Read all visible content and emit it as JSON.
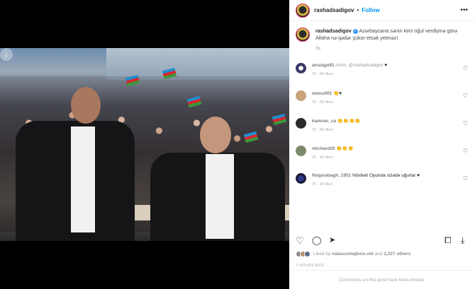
{
  "header": {
    "username": "rashadsadigov",
    "separator": "•",
    "follow_label": "Follow",
    "more_label": "•••"
  },
  "caption": {
    "username": "rashadsadigov",
    "text": "Azərbaycana sənin kimi oğul verdiyinə görə Allaha nə qədər şükür etsək yetməz!",
    "age": "7h"
  },
  "comments": [
    {
      "user": "ansiago91",
      "text": "Amin. @rashadsadigov",
      "emoji": "♥",
      "age": "7h",
      "likes": "26 likes"
    },
    {
      "user": "emosif01",
      "text": "",
      "emoji": "👏♥",
      "age": "7h",
      "likes": "32 likes"
    },
    {
      "user": "kamran_ca",
      "text": "",
      "emoji": "👏👏👏👏",
      "age": "7h",
      "likes": "26 likes"
    },
    {
      "user": "nlichard20",
      "text": "",
      "emoji": "👏👏👏",
      "age": "7h",
      "likes": "16 likes"
    },
    {
      "user": "floqarabagh_1951",
      "text": "Növbəti Oyunda sizədə uğurlar",
      "emoji": "♥",
      "age": "7h",
      "likes": "34 likes"
    }
  ],
  "liked_by": {
    "prefix": "Liked by",
    "user": "natasunhajbxio.mil",
    "and": "2,227 others"
  },
  "timestamp": "7 HOURS AGO",
  "limited_text": "Comments on this post have been limited.",
  "icons": {
    "download": "↓",
    "heart": "♡",
    "comment": "◯",
    "share": "➤",
    "save": "⧠",
    "post_download": "⤓"
  },
  "colors": {
    "follow": "#0095f6",
    "story_ring": "#e1306c",
    "like_red": "#ed4956"
  }
}
